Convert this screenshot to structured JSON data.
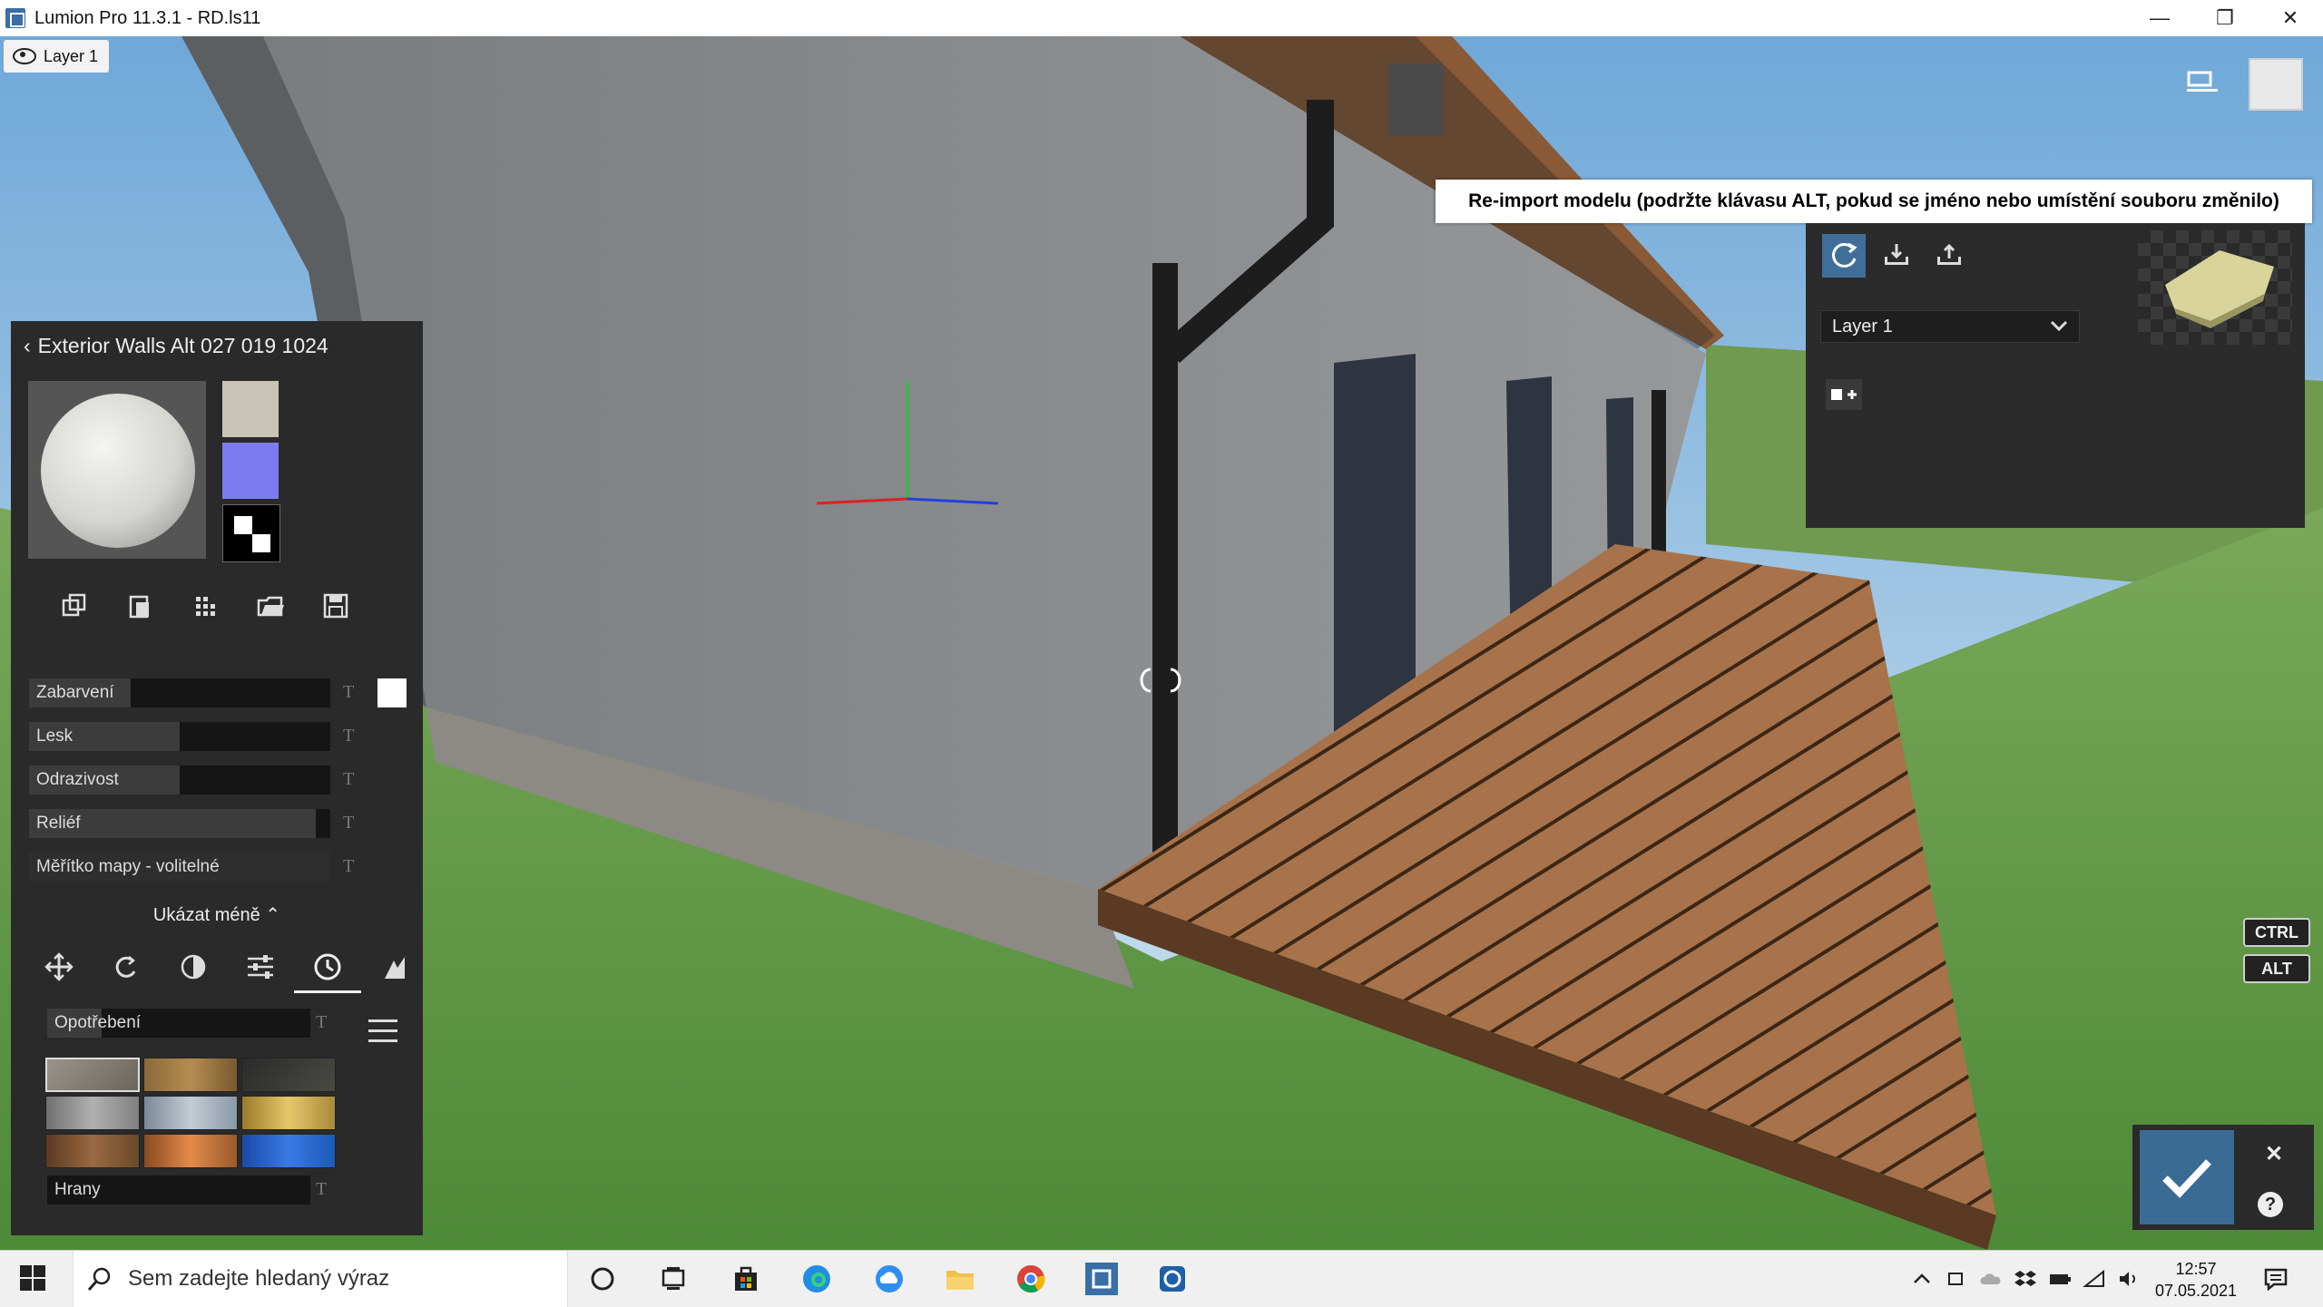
{
  "window": {
    "title": "Lumion Pro 11.3.1  - RD.ls11",
    "minimize": "—",
    "restore": "❐",
    "close": "✕"
  },
  "viewport": {
    "layer_badge": "Layer 1"
  },
  "tooltip": {
    "text": "Re-import modelu (podržte klávasu ALT, pokud se jméno nebo umístění souboru změnilo)"
  },
  "import_panel": {
    "layer_select": "Layer 1"
  },
  "material_panel": {
    "title": "Exterior Walls Alt 027 019 1024",
    "swatch_colors": [
      "#c9c4b6",
      "#7c7cf2"
    ],
    "properties": [
      {
        "label": "Zabarvení",
        "value": 0.0
      },
      {
        "label": "Lesk",
        "value": 0.5
      },
      {
        "label": "Odrazivost",
        "value": 0.5
      },
      {
        "label": "Reliéf",
        "value": 0.95
      },
      {
        "label": "Měřítko mapy - volitelné",
        "value": 1.0
      }
    ],
    "t_mark": "T",
    "show_less": "Ukázat méně ⌃",
    "weathering_label": "Opotřebení",
    "edges_label": "Hrany"
  },
  "keys": {
    "ctrl": "CTRL",
    "alt": "ALT"
  },
  "confirm": {
    "close": "✕",
    "help": "?"
  },
  "taskbar": {
    "search_placeholder": "Sem zadejte hledaný výraz",
    "time": "12:57",
    "date": "07.05.2021"
  }
}
